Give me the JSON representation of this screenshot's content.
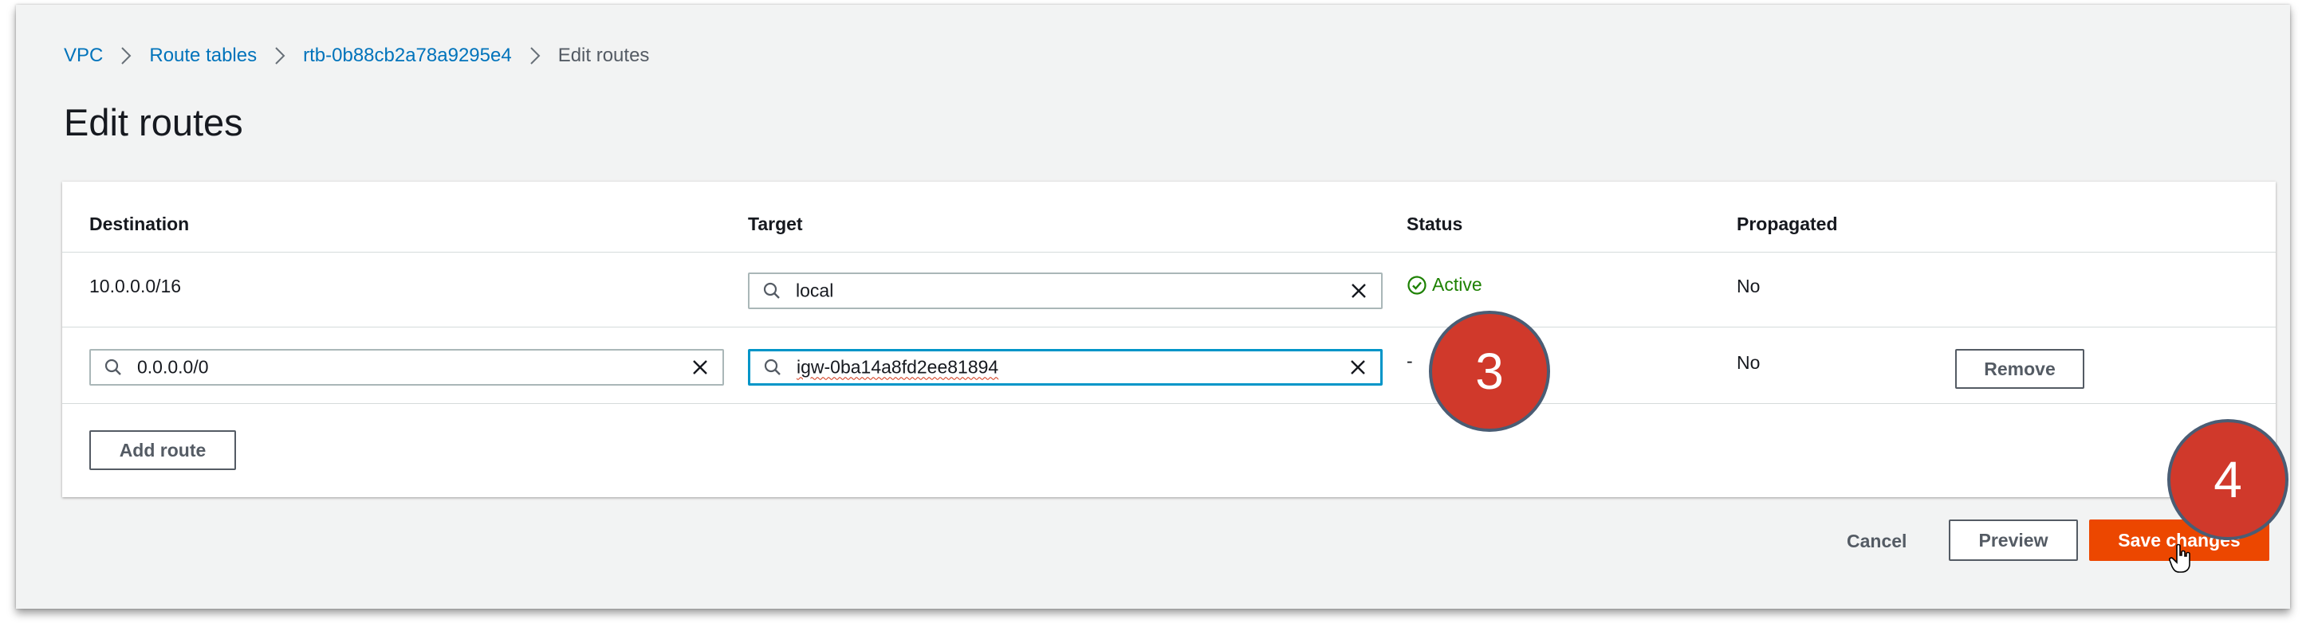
{
  "breadcrumb": {
    "items": [
      "VPC",
      "Route tables",
      "rtb-0b88cb2a78a9295e4"
    ],
    "current": "Edit routes"
  },
  "page": {
    "title": "Edit routes"
  },
  "table": {
    "headers": {
      "destination": "Destination",
      "target": "Target",
      "status": "Status",
      "propagated": "Propagated"
    },
    "rows": [
      {
        "destination": "10.0.0.0/16",
        "target": "local",
        "status": "Active",
        "propagated": "No"
      },
      {
        "destination": "0.0.0.0/0",
        "target": "igw-0ba14a8fd2ee81894",
        "status": "-",
        "propagated": "No",
        "remove_label": "Remove"
      }
    ],
    "add_route_label": "Add route"
  },
  "footer": {
    "cancel": "Cancel",
    "preview": "Preview",
    "save": "Save changes"
  },
  "annotations": {
    "step3": "3",
    "step4": "4"
  },
  "colors": {
    "link": "#0073bb",
    "active_status": "#1d8102",
    "primary_button": "#ec4700",
    "focus_border": "#0095c8",
    "step_marker": "#d0392b"
  },
  "icons": [
    "search-icon",
    "clear-icon",
    "check-circle-icon",
    "chevron-right-icon",
    "hand-cursor-icon"
  ]
}
